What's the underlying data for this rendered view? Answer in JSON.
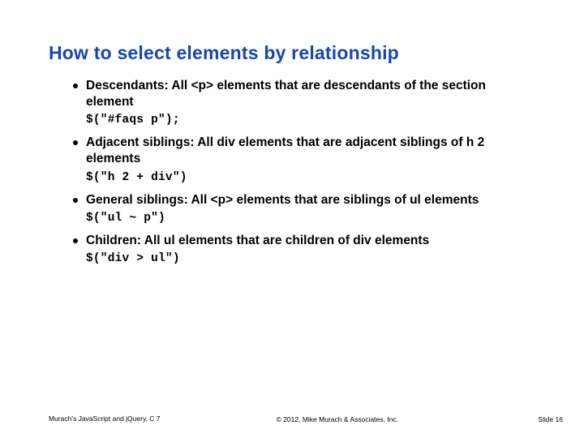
{
  "title": "How to select elements by relationship",
  "sections": [
    {
      "desc": "Descendants: All <p> elements that are descendants of the section element",
      "code": "$(\"#faqs p\");"
    },
    {
      "desc": "Adjacent siblings: All div elements that are adjacent siblings of h 2 elements",
      "code": "$(\"h 2 + div\")"
    },
    {
      "desc": "General siblings: All <p> elements that are siblings of ul elements",
      "code": "$(\"ul ~ p\")"
    },
    {
      "desc": "Children: All ul elements that are children of div elements",
      "code": "$(\"div > ul\")"
    }
  ],
  "footer": {
    "left": "Murach's JavaScript and jQuery, C 7",
    "center": "© 2012, Mike Murach & Associates, Inc.",
    "right": "Slide 16"
  }
}
